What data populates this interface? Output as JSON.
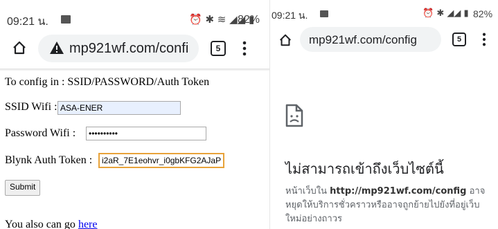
{
  "left": {
    "status": {
      "time": "09:21 น.",
      "battery": "82%"
    },
    "toolbar": {
      "url": "mp921wf.com/confi",
      "tab_count": "5"
    },
    "form": {
      "intro": "To config in : SSID/PASSWORD/Auth Token",
      "ssid_label": "SSID Wifi :",
      "ssid_value": "ASA-ENER",
      "password_label": "Password Wifi :",
      "password_value": "••••••••••",
      "token_label": "Blynk Auth Token :",
      "token_value": "i2aR_7E1eohvr_i0gbKFG2AJaP",
      "submit_label": "Submit",
      "footer_text": "You also can go",
      "footer_link": "here"
    }
  },
  "right": {
    "status": {
      "time": "09:21 น.",
      "battery": "82%"
    },
    "toolbar": {
      "url": "mp921wf.com/config",
      "tab_count": "5"
    },
    "error": {
      "title": "ไม่สามารถเข้าถึงเว็บไซต์นี้",
      "body_prefix": "หน้าเว็บใน",
      "body_url": "http://mp921wf.com/config",
      "body_suffix": "อาจหยุดให้บริการชั่วคราวหรืออาจถูกย้ายไปยังที่อยู่เว็บใหม่อย่างถาวร"
    }
  }
}
